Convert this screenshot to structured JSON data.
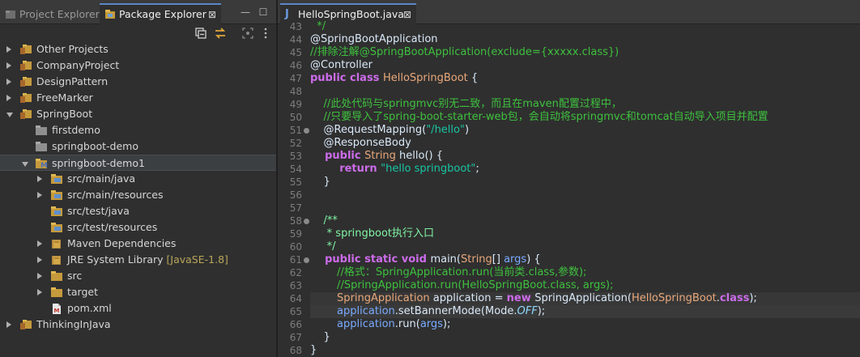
{
  "left_tabs": {
    "project_explorer": "Project Explorer",
    "package_explorer": "Package Explorer",
    "close": "⊠"
  },
  "window_buttons": {
    "minimize": "—",
    "maximize": "☐"
  },
  "tree": [
    {
      "label": "Other Projects",
      "decoration": "",
      "indent": 0,
      "arrow": "right",
      "icon": "project-folder"
    },
    {
      "label": "CompanyProject",
      "decoration": "",
      "indent": 0,
      "arrow": "right",
      "icon": "project-folder"
    },
    {
      "label": "DesignPattern",
      "decoration": "",
      "indent": 0,
      "arrow": "right",
      "icon": "project-folder"
    },
    {
      "label": "FreeMarker",
      "decoration": "",
      "indent": 0,
      "arrow": "right",
      "icon": "project-folder"
    },
    {
      "label": "SpringBoot",
      "decoration": "",
      "indent": 0,
      "arrow": "down",
      "icon": "project-folder"
    },
    {
      "label": "firstdemo",
      "decoration": "",
      "indent": 1,
      "arrow": "",
      "icon": "plain-folder"
    },
    {
      "label": "springboot-demo",
      "decoration": "",
      "indent": 1,
      "arrow": "",
      "icon": "plain-folder"
    },
    {
      "label": "springboot-demo1",
      "decoration": "",
      "indent": 1,
      "arrow": "down",
      "icon": "maven-project",
      "selected": true
    },
    {
      "label": "src/main/java",
      "decoration": "",
      "indent": 2,
      "arrow": "right",
      "icon": "source-folder"
    },
    {
      "label": "src/main/resources",
      "decoration": "",
      "indent": 2,
      "arrow": "right",
      "icon": "source-folder"
    },
    {
      "label": "src/test/java",
      "decoration": "",
      "indent": 2,
      "arrow": "",
      "icon": "source-folder"
    },
    {
      "label": "src/test/resources",
      "decoration": "",
      "indent": 2,
      "arrow": "",
      "icon": "source-folder"
    },
    {
      "label": "Maven Dependencies",
      "decoration": "",
      "indent": 2,
      "arrow": "right",
      "icon": "library"
    },
    {
      "label": "JRE System Library",
      "decoration": "[JavaSE-1.8]",
      "indent": 2,
      "arrow": "right",
      "icon": "library"
    },
    {
      "label": "src",
      "decoration": "",
      "indent": 2,
      "arrow": "right",
      "icon": "folder"
    },
    {
      "label": "target",
      "decoration": "",
      "indent": 2,
      "arrow": "right",
      "icon": "folder"
    },
    {
      "label": "pom.xml",
      "decoration": "",
      "indent": 2,
      "arrow": "",
      "icon": "xml-file"
    },
    {
      "label": "ThinkingInJava",
      "decoration": "",
      "indent": 0,
      "arrow": "right",
      "icon": "project-folder"
    }
  ],
  "editor": {
    "tab_badge": "J",
    "tab_label": "HelloSpringBoot.java",
    "close": "⊠",
    "lines": [
      {
        "n": "43",
        "fold": false,
        "hl": "",
        "tokens": [
          [
            "cmt",
            "  */"
          ]
        ]
      },
      {
        "n": "44",
        "fold": false,
        "hl": "",
        "tokens": [
          [
            "dflt",
            "@SpringBootApplication"
          ]
        ]
      },
      {
        "n": "45",
        "fold": false,
        "hl": "",
        "tokens": [
          [
            "cmt",
            "//排除注解@SpringBootApplication(exclude={xxxxx.class})"
          ]
        ]
      },
      {
        "n": "46",
        "fold": false,
        "hl": "",
        "tokens": [
          [
            "dflt",
            "@Controller"
          ]
        ]
      },
      {
        "n": "47",
        "fold": false,
        "hl": "",
        "tokens": [
          [
            "kw",
            "public class "
          ],
          [
            "ent",
            "HelloSpringBoot"
          ],
          [
            "dflt",
            " {"
          ]
        ]
      },
      {
        "n": "48",
        "fold": false,
        "hl": "",
        "tokens": []
      },
      {
        "n": "49",
        "fold": false,
        "hl": "",
        "tokens": [
          [
            "cmt",
            "    //此处代码与springmvc别无二致，而且在maven配置过程中，"
          ]
        ]
      },
      {
        "n": "50",
        "fold": false,
        "hl": "",
        "tokens": [
          [
            "cmt",
            "    //只要导入了spring-boot-starter-web包，会自动将springmvc和tomcat自动导入项目并配置"
          ]
        ]
      },
      {
        "n": "51",
        "fold": true,
        "hl": "",
        "tokens": [
          [
            "dflt",
            "    @RequestMapping("
          ],
          [
            "str",
            "\"/hello\""
          ],
          [
            "dflt",
            ")"
          ]
        ]
      },
      {
        "n": "52",
        "fold": false,
        "hl": "",
        "tokens": [
          [
            "dflt",
            "    @ResponseBody"
          ]
        ]
      },
      {
        "n": "53",
        "fold": false,
        "hl": "",
        "tokens": [
          [
            "kw",
            "    public "
          ],
          [
            "ent",
            "String"
          ],
          [
            "dflt",
            " hello() {"
          ]
        ]
      },
      {
        "n": "54",
        "fold": false,
        "hl": "",
        "tokens": [
          [
            "kw",
            "        return "
          ],
          [
            "str",
            "\"hello springboot\""
          ],
          [
            "dflt",
            ";"
          ]
        ]
      },
      {
        "n": "55",
        "fold": false,
        "hl": "",
        "tokens": [
          [
            "dflt",
            "    }"
          ]
        ]
      },
      {
        "n": "56",
        "fold": false,
        "hl": "",
        "tokens": []
      },
      {
        "n": "57",
        "fold": false,
        "hl": "",
        "tokens": []
      },
      {
        "n": "58",
        "fold": true,
        "hl": "",
        "tokens": [
          [
            "jdoc",
            "    /**"
          ]
        ]
      },
      {
        "n": "59",
        "fold": false,
        "hl": "",
        "tokens": [
          [
            "jdoc",
            "     * springboot执行入口"
          ]
        ]
      },
      {
        "n": "60",
        "fold": false,
        "hl": "",
        "tokens": [
          [
            "jdoc",
            "     */"
          ]
        ]
      },
      {
        "n": "61",
        "fold": true,
        "hl": "",
        "tokens": [
          [
            "kw",
            "    public static void "
          ],
          [
            "dflt",
            "main("
          ],
          [
            "ent",
            "String"
          ],
          [
            "dflt",
            "[] "
          ],
          [
            "var",
            "args"
          ],
          [
            "dflt",
            ") {"
          ]
        ]
      },
      {
        "n": "62",
        "fold": false,
        "hl": "",
        "tokens": [
          [
            "cmt",
            "        //格式：SpringApplication.run(当前类.class,参数);"
          ]
        ]
      },
      {
        "n": "63",
        "fold": false,
        "hl": "",
        "tokens": [
          [
            "cmt",
            "        //SpringApplication.run(HelloSpringBoot.class, args);"
          ]
        ]
      },
      {
        "n": "64",
        "fold": false,
        "hl": "hl",
        "tokens": [
          [
            "ent",
            "        SpringApplication"
          ],
          [
            "dflt",
            " application = "
          ],
          [
            "kw",
            "new "
          ],
          [
            "dflt",
            "SpringApplication("
          ],
          [
            "ent",
            "HelloSpringBoot"
          ],
          [
            "dflt",
            "."
          ],
          [
            "kw",
            "class"
          ],
          [
            "dflt",
            ");"
          ]
        ]
      },
      {
        "n": "65",
        "fold": false,
        "hl": "cur",
        "tokens": [
          [
            "var",
            "        application"
          ],
          [
            "dflt",
            ".setBannerMode(Mode."
          ],
          [
            "cnst",
            "OFF"
          ],
          [
            "dflt",
            ");"
          ]
        ]
      },
      {
        "n": "66",
        "fold": false,
        "hl": "",
        "tokens": [
          [
            "var",
            "        application"
          ],
          [
            "dflt",
            ".run("
          ],
          [
            "var",
            "args"
          ],
          [
            "dflt",
            ");"
          ]
        ]
      },
      {
        "n": "67",
        "fold": false,
        "hl": "",
        "tokens": [
          [
            "dflt",
            "    }"
          ]
        ]
      },
      {
        "n": "68",
        "fold": false,
        "hl": "",
        "tokens": [
          [
            "dflt",
            "}"
          ]
        ]
      }
    ]
  },
  "colors": {
    "background": "#2f2f2f",
    "tab_active_border": "#5b87c9",
    "comment": "#3ec13e",
    "keyword": "#cc6cea",
    "string": "#17c6a3",
    "class": "#e9a87b",
    "variable": "#79abff"
  }
}
